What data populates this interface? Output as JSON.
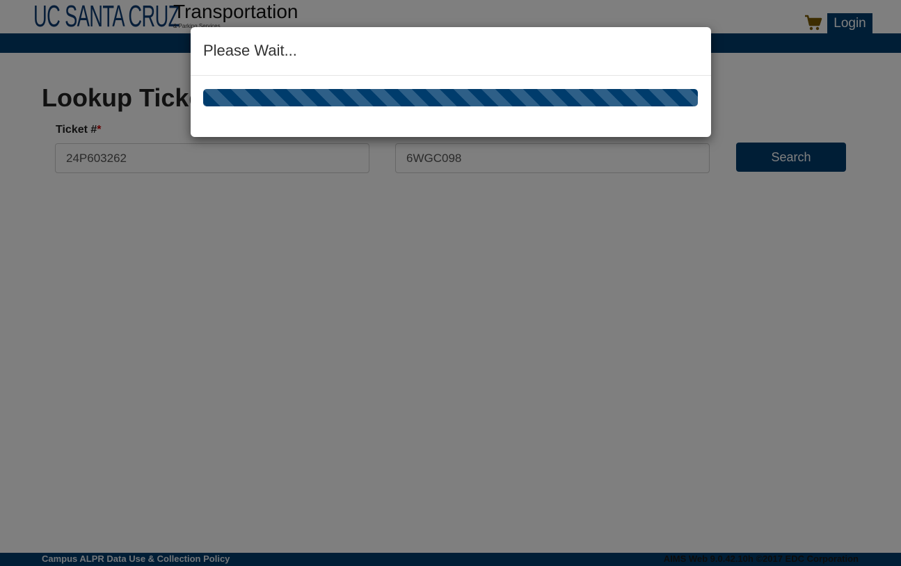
{
  "header": {
    "logo_ucsc": "UC SANTA CRUZ",
    "logo_title": "Transportation",
    "logo_subtitle": "& Parking Services",
    "cart_icon": "shopping-cart-icon",
    "login_label": "Login"
  },
  "main": {
    "title": "Lookup Ticket",
    "ticket_label": "Ticket #",
    "required_marker": "*",
    "ticket_value": "24P603262",
    "plate_value": "6WGC098",
    "search_label": "Search"
  },
  "footer": {
    "policy_link": "Campus ALPR Data Use & Collection Policy",
    "version": "AIMS Web 9.0.42.10h ©2017 EDC Corporation"
  },
  "modal": {
    "title": "Please Wait...",
    "progress": 1.0
  },
  "colors": {
    "brand": "#003c6c",
    "cart": "#7a5a00",
    "required": "#cc0000"
  }
}
